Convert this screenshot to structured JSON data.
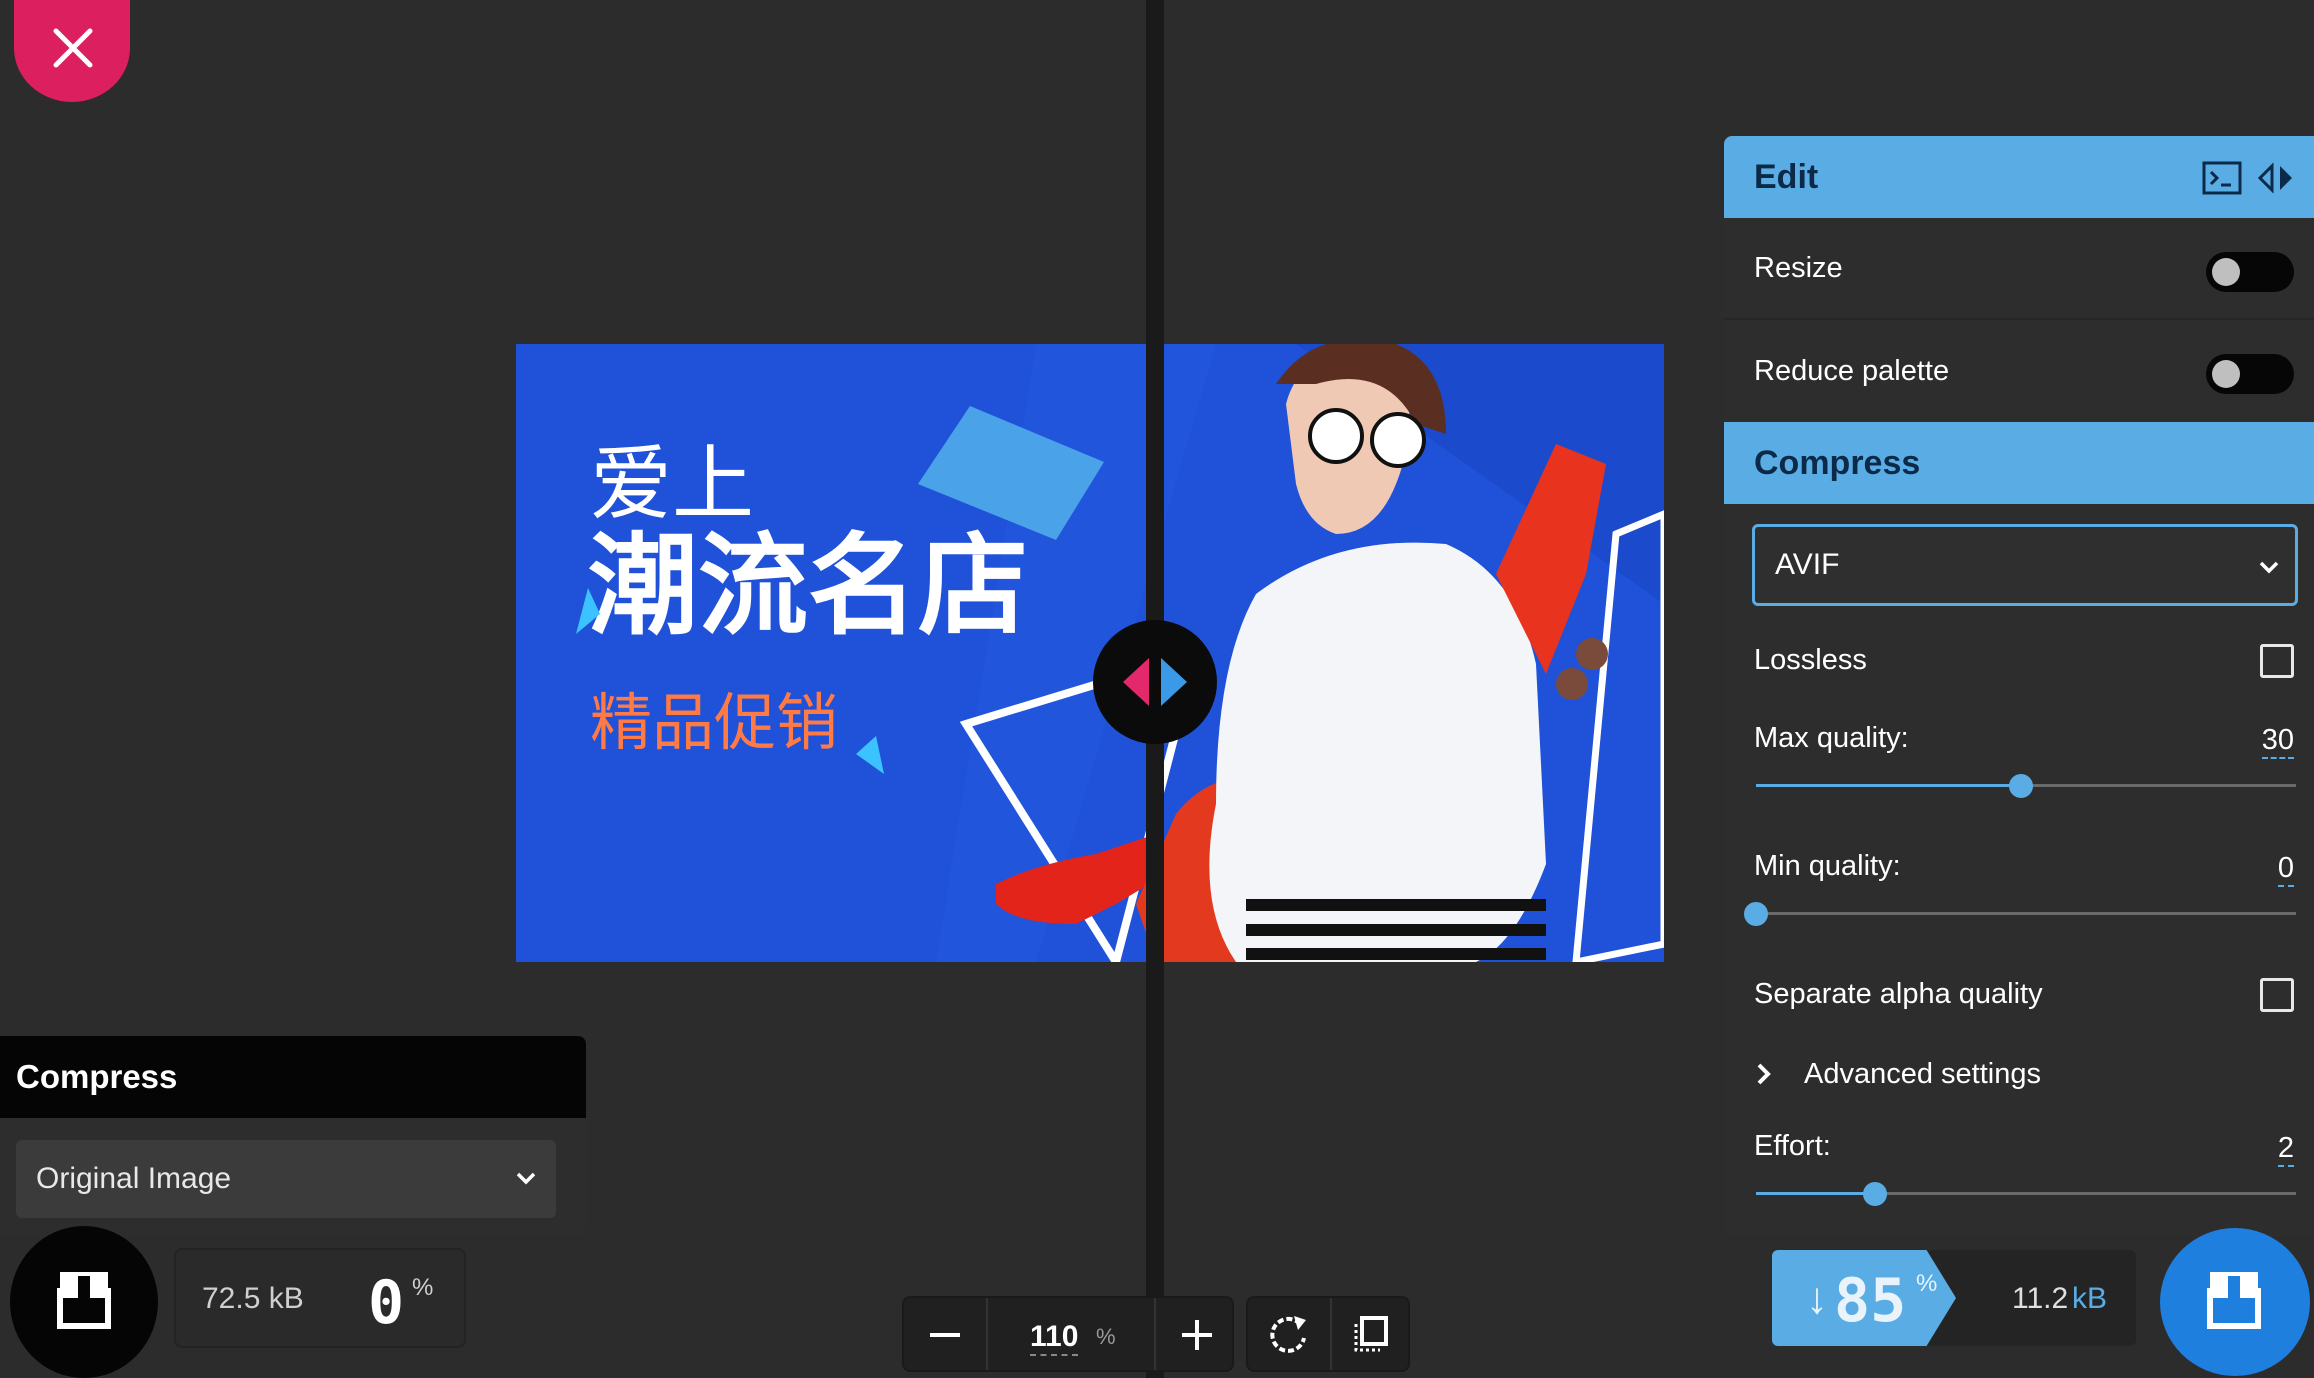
{
  "close_button": {
    "icon": "close-icon"
  },
  "image": {
    "headline_small": "爱上",
    "headline_large": "潮流名店",
    "headline_sub": "精品促销"
  },
  "left_panel": {
    "title": "Compress",
    "method_value": "Original Image",
    "size": "72.5 kB",
    "savings_value": "0",
    "savings_unit": "%"
  },
  "zoom": {
    "value": "110",
    "unit": "%"
  },
  "right_panel": {
    "edit": {
      "title": "Edit",
      "options": [
        {
          "label": "Resize",
          "enabled": false
        },
        {
          "label": "Reduce palette",
          "enabled": false
        }
      ]
    },
    "compress": {
      "title": "Compress",
      "format_value": "AVIF",
      "lossless_label": "Lossless",
      "lossless_checked": false,
      "max_quality_label": "Max quality:",
      "max_quality_value": "30",
      "max_quality_fraction": 0.49,
      "min_quality_label": "Min quality:",
      "min_quality_value": "0",
      "min_quality_fraction": 0.0,
      "separate_alpha_label": "Separate alpha quality",
      "separate_alpha_checked": false,
      "advanced_label": "Advanced settings",
      "effort_label": "Effort:",
      "effort_value": "2",
      "effort_fraction": 0.22
    },
    "savings": {
      "arrow": "↓",
      "value": "85",
      "unit": "%",
      "size_value": "11.2",
      "size_unit": "kB"
    }
  },
  "colors": {
    "accent": "#5aade4",
    "close": "#dc1f5e",
    "download_primary": "#1e7fde"
  }
}
